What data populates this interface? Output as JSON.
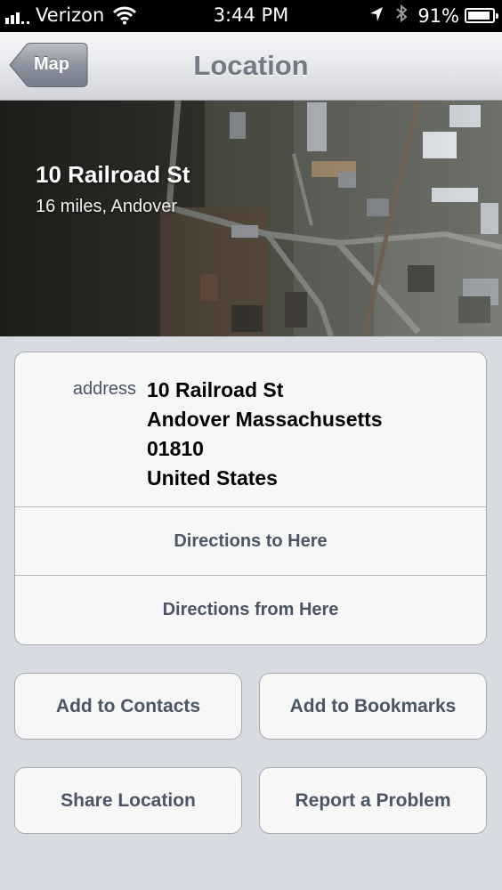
{
  "status_bar": {
    "carrier": "Verizon",
    "time": "3:44 PM",
    "battery_percent": "91%",
    "battery_level": 0.91,
    "icons": [
      "signal-icon",
      "wifi-icon",
      "location-arrow-icon",
      "bluetooth-icon",
      "battery-icon"
    ]
  },
  "nav": {
    "title": "Location",
    "back_label": "Map"
  },
  "header": {
    "place_name": "10 Railroad St",
    "place_detail": "16 miles, Andover"
  },
  "address": {
    "label": "address",
    "lines": [
      "10 Railroad St",
      "Andover Massachusetts",
      "01810",
      "United States"
    ]
  },
  "actions": {
    "directions_to": "Directions to Here",
    "directions_from": "Directions from Here",
    "add_contacts": "Add to Contacts",
    "add_bookmarks": "Add to Bookmarks",
    "share_location": "Share Location",
    "report_problem": "Report a Problem"
  },
  "colors": {
    "nav_title": "#737985",
    "button_text": "#4c5566",
    "background": "#d8dbe2"
  }
}
